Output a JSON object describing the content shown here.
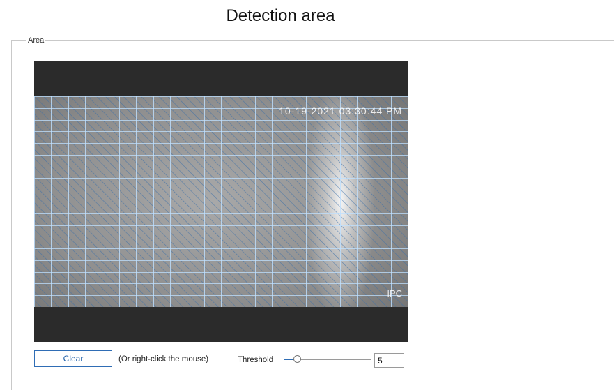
{
  "page": {
    "title": "Detection area"
  },
  "area": {
    "legend": "Area"
  },
  "video": {
    "osd_time": "10-19-2021 03:30:44 PM",
    "osd_channel": "IPC",
    "grid": {
      "columns": 22,
      "rows": 18,
      "all_selected": true
    },
    "colors": {
      "grid_line": "#bfe0ff",
      "hatch": "#3b6ea8",
      "letterbox": "#2b2b2b"
    }
  },
  "controls": {
    "clear_label": "Clear",
    "hint": "(Or right-click the mouse)",
    "threshold_label": "Threshold",
    "threshold_value": "5",
    "threshold_min": 0,
    "threshold_max": 100,
    "accent": "#2f6db5"
  }
}
